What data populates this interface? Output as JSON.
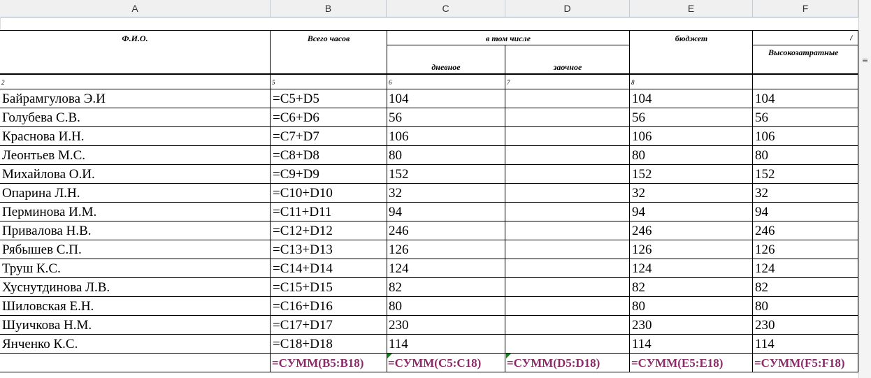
{
  "columns": [
    "A",
    "B",
    "C",
    "D",
    "E",
    "F"
  ],
  "header": {
    "fio": "Ф.И.О.",
    "total_hours": "Всего часов",
    "including": "в том числе",
    "day": "дневное",
    "correspondence": "заочное",
    "budget": "бюджет",
    "high_cost": "Высокозатратные",
    "col_g_partial": "/"
  },
  "number_row": [
    "2",
    "5",
    "6",
    "7",
    "8",
    ""
  ],
  "rows": [
    {
      "name": "Байрамгулова Э.И",
      "total": "=C5+D5",
      "day": "104",
      "zaoch": "",
      "budget": "104",
      "high": "104"
    },
    {
      "name": "Голубева С.В.",
      "total": "=C6+D6",
      "day": "56",
      "zaoch": "",
      "budget": "56",
      "high": "56"
    },
    {
      "name": "Краснова И.Н.",
      "total": "=C7+D7",
      "day": "106",
      "zaoch": "",
      "budget": "106",
      "high": "106"
    },
    {
      "name": "Леонтьев М.С.",
      "total": "=C8+D8",
      "day": "80",
      "zaoch": "",
      "budget": "80",
      "high": "80"
    },
    {
      "name": "Михайлова О.И.",
      "total": "=C9+D9",
      "day": "152",
      "zaoch": "",
      "budget": "152",
      "high": "152"
    },
    {
      "name": "Опарина Л.Н.",
      "total": "=C10+D10",
      "day": "32",
      "zaoch": "",
      "budget": "32",
      "high": "32"
    },
    {
      "name": "Перминова И.М.",
      "total": "=C11+D11",
      "day": "94",
      "zaoch": "",
      "budget": "94",
      "high": "94"
    },
    {
      "name": "Привалова Н.В.",
      "total": "=C12+D12",
      "day": "246",
      "zaoch": "",
      "budget": "246",
      "high": "246"
    },
    {
      "name": "Рябышев С.П.",
      "total": "=C13+D13",
      "day": "126",
      "zaoch": "",
      "budget": "126",
      "high": "126"
    },
    {
      "name": "Труш К.С.",
      "total": "=C14+D14",
      "day": "124",
      "zaoch": "",
      "budget": "124",
      "high": "124"
    },
    {
      "name": "Хуснутдинова Л.В.",
      "total": "=C15+D15",
      "day": "82",
      "zaoch": "",
      "budget": "82",
      "high": "82"
    },
    {
      "name": "Шиловская Е.Н.",
      "total": "=C16+D16",
      "day": "80",
      "zaoch": "",
      "budget": "80",
      "high": "80"
    },
    {
      "name": "Шуичкова Н.М.",
      "total": "=C17+D17",
      "day": "230",
      "zaoch": "",
      "budget": "230",
      "high": "230"
    },
    {
      "name": "Янченко К.С.",
      "total": "=C18+D18",
      "day": "114",
      "zaoch": "",
      "budget": "114",
      "high": "114"
    }
  ],
  "sum_row": [
    "",
    "=СУММ(B5:B18)",
    "=СУММ(C5:C18)",
    "=СУММ(D5:D18)",
    "=СУММ(E5:E18)",
    "=СУММ(F5:F18)"
  ],
  "colors": {
    "formula": "#8b2c6a",
    "error_triangle": "#1e7b1e",
    "header_bg": "#f0f0f0"
  },
  "scrollbar": {
    "icon": "split-lines-icon",
    "glyph": "≡"
  }
}
